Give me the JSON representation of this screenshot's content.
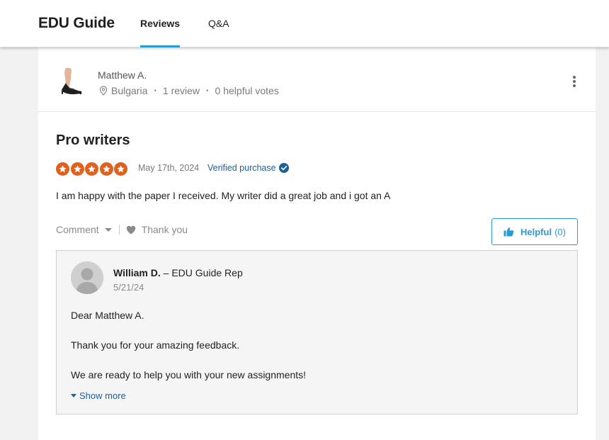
{
  "header": {
    "brand": "EDU Guide",
    "tabs": [
      {
        "label": "Reviews",
        "active": true
      },
      {
        "label": "Q&A",
        "active": false
      }
    ],
    "accent_color": "#2a9bd1"
  },
  "review": {
    "author": {
      "name": "Matthew A.",
      "location": "Bulgaria",
      "reviews": "1 review",
      "helpful_votes": "0 helpful votes",
      "avatar_icon": "high-heel-shoe-avatar"
    },
    "title": "Pro writers",
    "rating": 5,
    "rating_max": 5,
    "star_color": "#e0601e",
    "date": "May 17th, 2024",
    "verified_label": "Verified purchase",
    "body": "I am happy with the paper I received. My writer did a great job and i got an A",
    "actions": {
      "comment_label": "Comment",
      "thank_label": "Thank you",
      "helpful_label": "Helpful",
      "helpful_count": "(0)"
    }
  },
  "reply": {
    "name": "William D.",
    "role": " – EDU Guide Rep",
    "date": "5/21/24",
    "lines": [
      "Dear Matthew A.",
      "Thank you for your amazing feedback.",
      "We are ready to help you with your new assignments!"
    ],
    "show_more_label": "Show more"
  }
}
